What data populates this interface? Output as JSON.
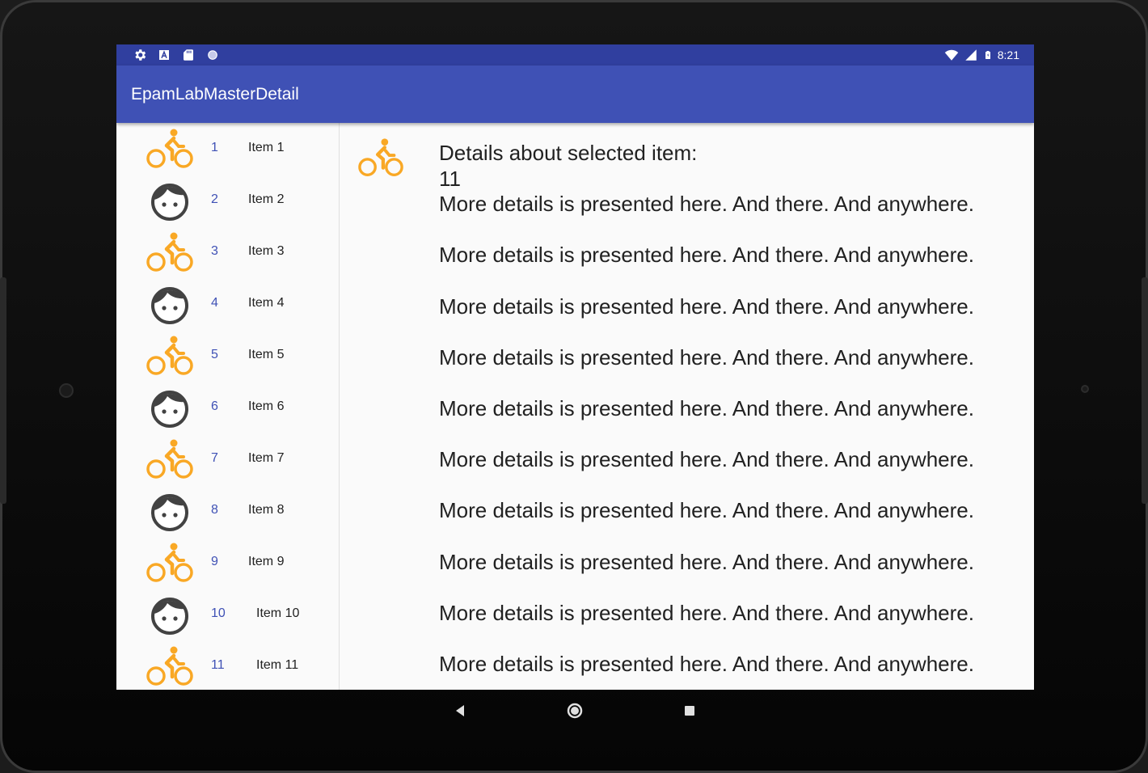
{
  "status_bar": {
    "time": "8:21"
  },
  "app_bar": {
    "title": "EpamLabMasterDetail"
  },
  "list": {
    "items": [
      {
        "number": "1",
        "label": "Item 1",
        "icon": "bike-icon"
      },
      {
        "number": "2",
        "label": "Item 2",
        "icon": "face-icon"
      },
      {
        "number": "3",
        "label": "Item 3",
        "icon": "bike-icon"
      },
      {
        "number": "4",
        "label": "Item 4",
        "icon": "face-icon"
      },
      {
        "number": "5",
        "label": "Item 5",
        "icon": "bike-icon"
      },
      {
        "number": "6",
        "label": "Item 6",
        "icon": "face-icon"
      },
      {
        "number": "7",
        "label": "Item 7",
        "icon": "bike-icon"
      },
      {
        "number": "8",
        "label": "Item 8",
        "icon": "face-icon"
      },
      {
        "number": "9",
        "label": "Item 9",
        "icon": "bike-icon"
      },
      {
        "number": "10",
        "label": "Item 10",
        "icon": "face-icon"
      },
      {
        "number": "11",
        "label": "Item 11",
        "icon": "bike-icon"
      }
    ]
  },
  "detail": {
    "icon": "bike-icon",
    "heading": "Details about selected item:",
    "item_id": "11",
    "lines": [
      "More details is presented here. And there. And anywhere.",
      "",
      "More details is presented here. And there. And anywhere.",
      "",
      "More details is presented here. And there. And anywhere.",
      "",
      "More details is presented here. And there. And anywhere.",
      "",
      "More details is presented here. And there. And anywhere.",
      "",
      "More details is presented here. And there. And anywhere.",
      "",
      "More details is presented here. And there. And anywhere.",
      "",
      "More details is presented here. And there. And anywhere.",
      "",
      "More details is presented here. And there. And anywhere.",
      "",
      "More details is presented here. And there. And anywhere."
    ]
  },
  "colors": {
    "primary": "#3f51b5",
    "primary_dark": "#303f9f",
    "bike": "#f9a825",
    "face": "#424242"
  }
}
